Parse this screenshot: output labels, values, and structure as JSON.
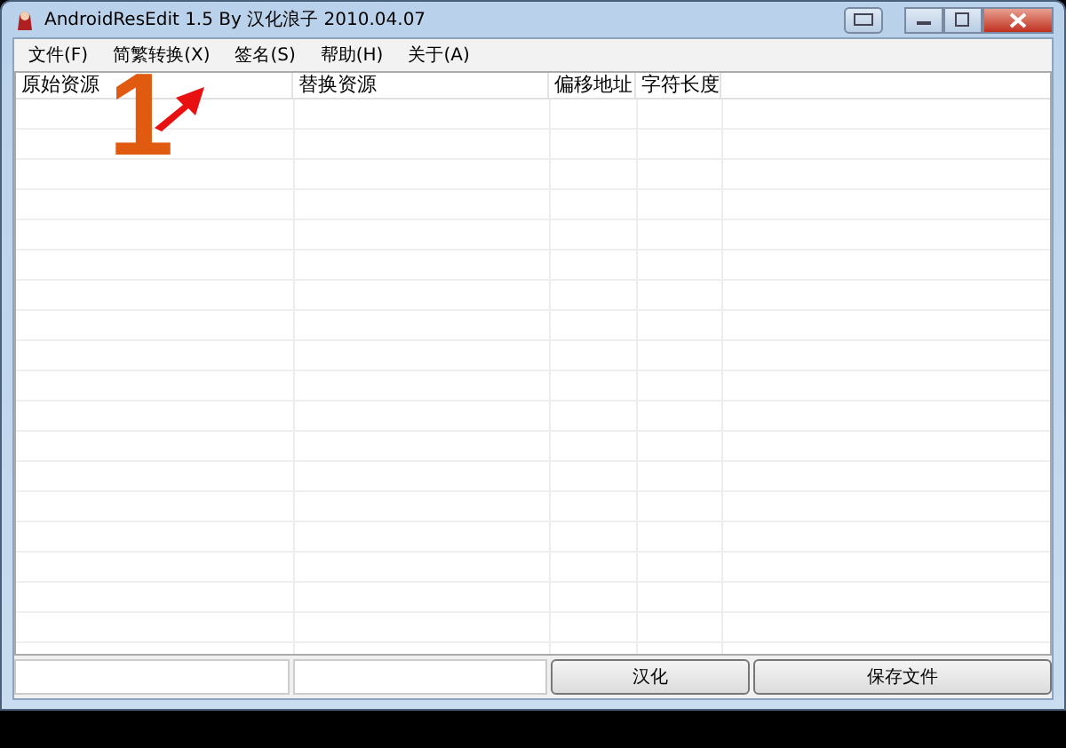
{
  "window": {
    "title": "AndroidResEdit 1.5 By 汉化浪子 2010.04.07"
  },
  "menu": [
    "文件(F)",
    "简繁转换(X)",
    "签名(S)",
    "帮助(H)",
    "关于(A)"
  ],
  "table": {
    "columns": [
      "原始资源",
      "替换资源",
      "偏移地址",
      "字符长度"
    ]
  },
  "annotation": {
    "number": "1"
  },
  "bottom": {
    "buttons": [
      "汉化",
      "保存文件"
    ]
  }
}
